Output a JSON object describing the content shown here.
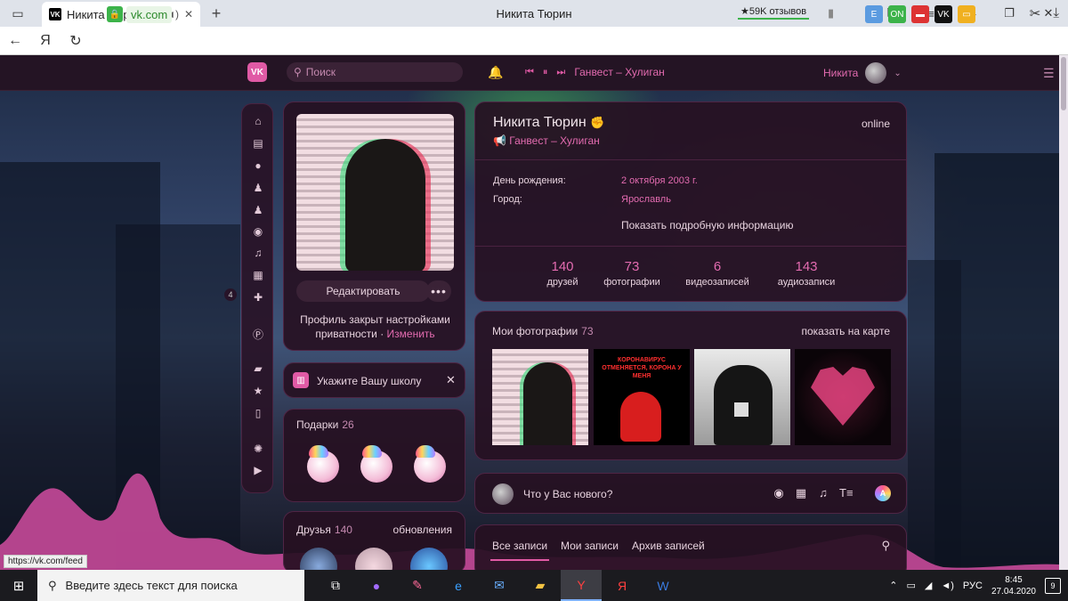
{
  "browser": {
    "tab_title": "Никита Тюрин",
    "url_host": "vk.com",
    "page_title": "Никита Тюрин",
    "reviews": "★59K отзывов",
    "yandex_button": "Я",
    "ext_on_label": "ON"
  },
  "vk": {
    "logo": "VK",
    "search_placeholder": "Поиск",
    "now_playing": "Ганвест – Хулиган",
    "user_name": "Никита",
    "nav_badge": "4",
    "edit_button": "Редактировать",
    "privacy_text": "Профиль закрыт настройками приватности",
    "privacy_link": "Изменить",
    "school_prompt": "Укажите Вашу школу",
    "gifts": {
      "label": "Подарки",
      "count": "26"
    },
    "friends": {
      "label": "Друзья",
      "count": "140",
      "updates": "обновления"
    },
    "profile": {
      "name": "Никита Тюрин",
      "online": "online",
      "status": "Ганвест – Хулиган",
      "birthday_label": "День рождения:",
      "birthday_value": "2 октября 2003 г.",
      "city_label": "Город:",
      "city_value": "Ярославль",
      "show_more": "Показать подробную информацию",
      "stats": [
        {
          "n": "140",
          "t": "друзей"
        },
        {
          "n": "73",
          "t": "фотографии"
        },
        {
          "n": "6",
          "t": "видеозаписей"
        },
        {
          "n": "143",
          "t": "аудиозаписи"
        }
      ]
    },
    "photos": {
      "label": "Мои фотографии",
      "count": "73",
      "map_link": "показать на карте",
      "photo2_text": "КОРОНАВИРУС ОТМЕНЯЕТСЯ, КОРОНА У МЕНЯ"
    },
    "post_placeholder": "Что у Вас нового?",
    "wall_tabs": [
      "Все записи",
      "Мои записи",
      "Архив записей"
    ]
  },
  "status_url": "https://vk.com/feed",
  "taskbar": {
    "search_placeholder": "Введите здесь текст для поиска",
    "lang": "РУС",
    "time": "8:45",
    "date": "27.04.2020",
    "notifications": "9"
  },
  "colors": {
    "accent": "#e05aa5",
    "link": "#e36bb0",
    "card": "#26102280"
  }
}
